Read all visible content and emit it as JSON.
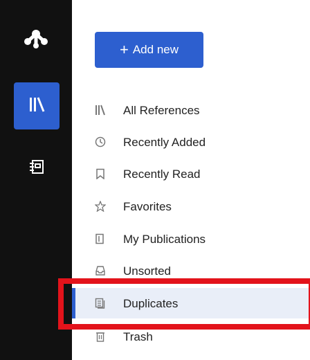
{
  "add_button": {
    "label": "Add new"
  },
  "nav": [
    {
      "label": "All References",
      "icon": "library-icon"
    },
    {
      "label": "Recently Added",
      "icon": "clock-icon"
    },
    {
      "label": "Recently Read",
      "icon": "bookmark-icon"
    },
    {
      "label": "Favorites",
      "icon": "star-icon"
    },
    {
      "label": "My Publications",
      "icon": "publication-icon"
    },
    {
      "label": "Unsorted",
      "icon": "inbox-icon"
    },
    {
      "label": "Duplicates",
      "icon": "duplicate-icon"
    },
    {
      "label": "Trash",
      "icon": "trash-icon"
    }
  ],
  "selected_item": "Duplicates",
  "colors": {
    "accent": "#2d5fcf",
    "rail": "#111111",
    "highlight": "#e3131b",
    "selected_bg": "#e9eef8"
  }
}
